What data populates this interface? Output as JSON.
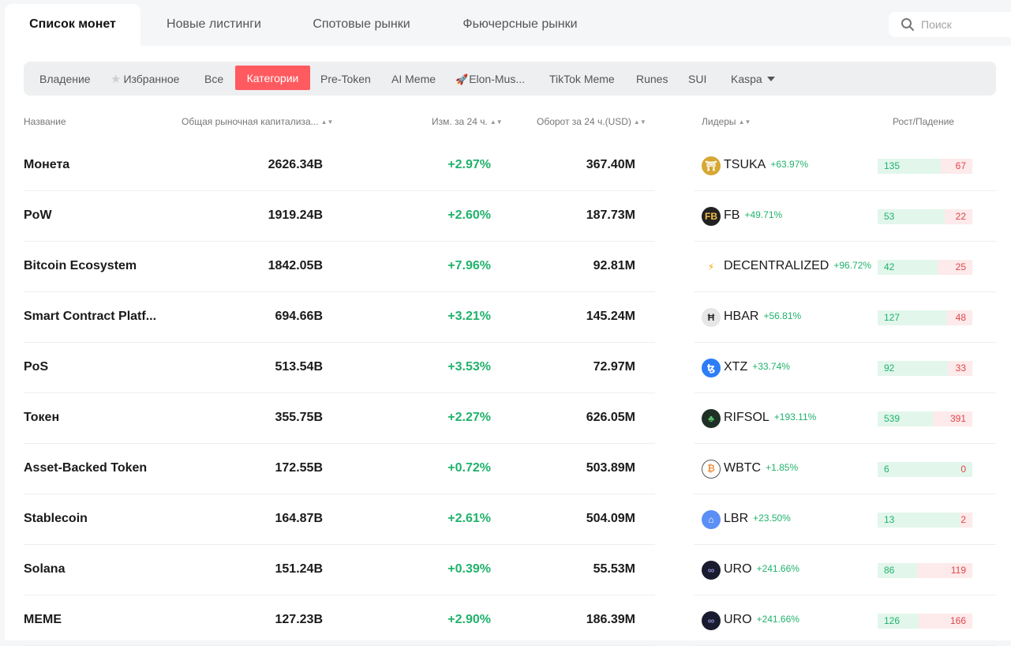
{
  "top_tabs": [
    "Список монет",
    "Новые листинги",
    "Спотовые рынки",
    "Фьючерсные рынки"
  ],
  "search": {
    "placeholder": "Поиск"
  },
  "categories": [
    "Владение",
    "Избранное",
    "Все",
    "Категории",
    "Pre-Token",
    "AI Meme",
    "Elon-Mus...",
    "TikTok Meme",
    "Runes",
    "SUI",
    "Kaspa"
  ],
  "active_category": "Категории",
  "table": {
    "headers": {
      "name": "Название",
      "cap": "Общая рыночная капитализа...",
      "change": "Изм. за 24 ч.",
      "volume": "Оборот за 24 ч.(USD)",
      "leaders": "Лидеры",
      "rise_fall": "Рост/Падение"
    },
    "rows": [
      {
        "name": "Монета",
        "cap": "2626.34B",
        "change": "+2.97%",
        "volume": "367.40M",
        "leader": "TSUKA",
        "leader_change": "+63.97%",
        "up": "135",
        "down": "67",
        "up_fraction": 0.67
      },
      {
        "name": "PoW",
        "cap": "1919.24B",
        "change": "+2.60%",
        "volume": "187.73M",
        "leader": "FB",
        "leader_change": "+49.71%",
        "up": "53",
        "down": "22",
        "up_fraction": 0.71
      },
      {
        "name": "Bitcoin Ecosystem",
        "cap": "1842.05B",
        "change": "+7.96%",
        "volume": "92.81M",
        "leader": "DECENTRALIZED",
        "leader_change": "+96.72%",
        "up": "42",
        "down": "25",
        "up_fraction": 0.63
      },
      {
        "name": "Smart Contract Platf...",
        "cap": "694.66B",
        "change": "+3.21%",
        "volume": "145.24M",
        "leader": "HBAR",
        "leader_change": "+56.81%",
        "up": "127",
        "down": "48",
        "up_fraction": 0.73
      },
      {
        "name": "PoS",
        "cap": "513.54B",
        "change": "+3.53%",
        "volume": "72.97M",
        "leader": "XTZ",
        "leader_change": "+33.74%",
        "up": "92",
        "down": "33",
        "up_fraction": 0.74
      },
      {
        "name": "Токен",
        "cap": "355.75B",
        "change": "+2.27%",
        "volume": "626.05M",
        "leader": "RIFSOL",
        "leader_change": "+193.11%",
        "up": "539",
        "down": "391",
        "up_fraction": 0.58
      },
      {
        "name": "Asset-Backed Token",
        "cap": "172.55B",
        "change": "+0.72%",
        "volume": "503.89M",
        "leader": "WBTC",
        "leader_change": "+1.85%",
        "up": "6",
        "down": "0",
        "up_fraction": 1.0
      },
      {
        "name": "Stablecoin",
        "cap": "164.87B",
        "change": "+2.61%",
        "volume": "504.09M",
        "leader": "LBR",
        "leader_change": "+23.50%",
        "up": "13",
        "down": "2",
        "up_fraction": 0.87
      },
      {
        "name": "Solana",
        "cap": "151.24B",
        "change": "+0.39%",
        "volume": "55.53M",
        "leader": "URO",
        "leader_change": "+241.66%",
        "up": "86",
        "down": "119",
        "up_fraction": 0.42
      },
      {
        "name": "MEME",
        "cap": "127.23B",
        "change": "+2.90%",
        "volume": "186.39M",
        "leader": "URO",
        "leader_change": "+241.66%",
        "up": "126",
        "down": "166",
        "up_fraction": 0.43
      }
    ]
  },
  "colors": {
    "accent": "#ff5a5f",
    "up": "#20b26c",
    "down": "#e0464c"
  }
}
